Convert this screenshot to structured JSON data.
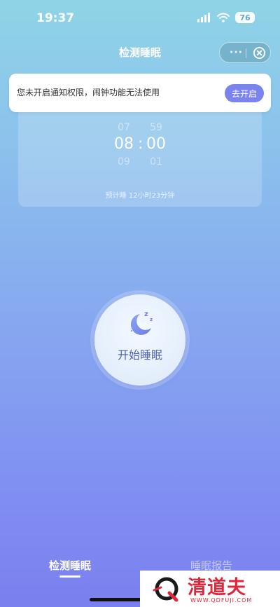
{
  "status_bar": {
    "time": "19:37",
    "battery": "76"
  },
  "nav": {
    "title": "检测睡眠",
    "more": "···"
  },
  "notice": {
    "text": "您未开启通知权限，闹钟功能无法使用",
    "button": "去开启"
  },
  "alarm": {
    "hour_prev": "07",
    "hour": "08",
    "hour_next": "09",
    "minute_prev": "59",
    "minute": "00",
    "minute_next": "01",
    "separator": ":",
    "estimate": "预计睡 12小时23分钟"
  },
  "start": {
    "label": "开始睡眠"
  },
  "tabs": [
    {
      "label": "检测睡眠",
      "active": true
    },
    {
      "label": "睡眠报告",
      "active": false
    }
  ],
  "watermark": {
    "name": "清道夫",
    "url": "WWW.QDFUJI.COM"
  },
  "colors": {
    "accent": "#7b84ee",
    "button_text": "#4f63a8",
    "watermark": "#e0263a"
  }
}
